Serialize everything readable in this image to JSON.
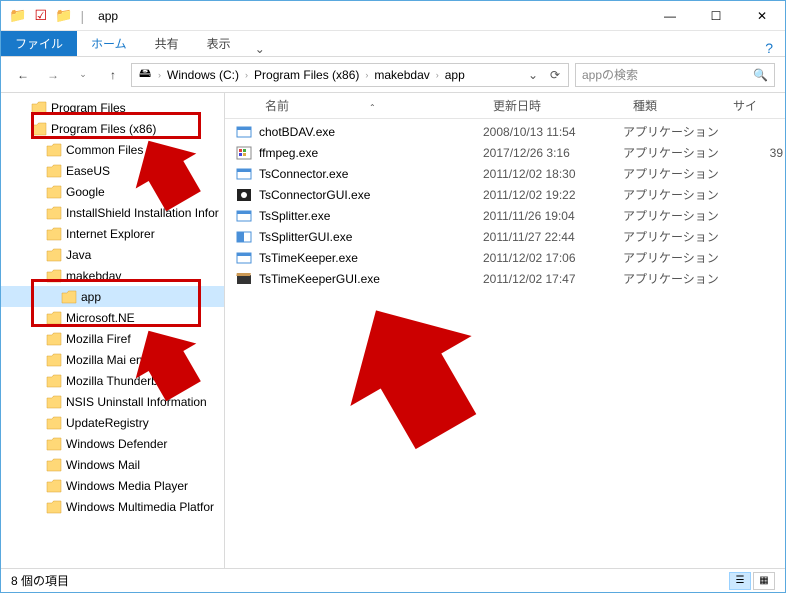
{
  "title": "app",
  "ribbon": {
    "file": "ファイル",
    "home": "ホーム",
    "share": "共有",
    "view": "表示"
  },
  "nav": {
    "drive": "Windows (C:)",
    "pf": "Program Files (x86)",
    "mk": "makebdav",
    "app": "app"
  },
  "search_placeholder": "appの検索",
  "columns": {
    "name": "名前",
    "date": "更新日時",
    "type": "種類",
    "size": "サイ"
  },
  "tree": [
    {
      "indent": 30,
      "label": "Program Files"
    },
    {
      "indent": 30,
      "label": "Program Files (x86)"
    },
    {
      "indent": 45,
      "label": "Common Files"
    },
    {
      "indent": 45,
      "label": "EaseUS"
    },
    {
      "indent": 45,
      "label": "Google"
    },
    {
      "indent": 45,
      "label": "InstallShield Installation Infor"
    },
    {
      "indent": 45,
      "label": "Internet Explorer"
    },
    {
      "indent": 45,
      "label": "Java"
    },
    {
      "indent": 45,
      "label": "makebdav"
    },
    {
      "indent": 60,
      "label": "app",
      "sel": true
    },
    {
      "indent": 45,
      "label": "Microsoft.NE"
    },
    {
      "indent": 45,
      "label": "Mozilla Firef"
    },
    {
      "indent": 45,
      "label": "Mozilla Mai                   ervice"
    },
    {
      "indent": 45,
      "label": "Mozilla Thunderbird"
    },
    {
      "indent": 45,
      "label": "NSIS Uninstall Information"
    },
    {
      "indent": 45,
      "label": "UpdateRegistry"
    },
    {
      "indent": 45,
      "label": "Windows Defender"
    },
    {
      "indent": 45,
      "label": "Windows Mail"
    },
    {
      "indent": 45,
      "label": "Windows Media Player"
    },
    {
      "indent": 45,
      "label": "Windows Multimedia Platfor"
    }
  ],
  "files": [
    {
      "icon": "exe1",
      "name": "chotBDAV.exe",
      "date": "2008/10/13 11:54",
      "type": "アプリケーション",
      "size": ""
    },
    {
      "icon": "exe2",
      "name": "ffmpeg.exe",
      "date": "2017/12/26 3:16",
      "type": "アプリケーション",
      "size": "39"
    },
    {
      "icon": "exe1",
      "name": "TsConnector.exe",
      "date": "2011/12/02 18:30",
      "type": "アプリケーション",
      "size": ""
    },
    {
      "icon": "exe3",
      "name": "TsConnectorGUI.exe",
      "date": "2011/12/02 19:22",
      "type": "アプリケーション",
      "size": ""
    },
    {
      "icon": "exe1",
      "name": "TsSplitter.exe",
      "date": "2011/11/26 19:04",
      "type": "アプリケーション",
      "size": ""
    },
    {
      "icon": "exe4",
      "name": "TsSplitterGUI.exe",
      "date": "2011/11/27 22:44",
      "type": "アプリケーション",
      "size": ""
    },
    {
      "icon": "exe1",
      "name": "TsTimeKeeper.exe",
      "date": "2011/12/02 17:06",
      "type": "アプリケーション",
      "size": ""
    },
    {
      "icon": "exe5",
      "name": "TsTimeKeeperGUI.exe",
      "date": "2011/12/02 17:47",
      "type": "アプリケーション",
      "size": ""
    }
  ],
  "status": "8 個の項目"
}
